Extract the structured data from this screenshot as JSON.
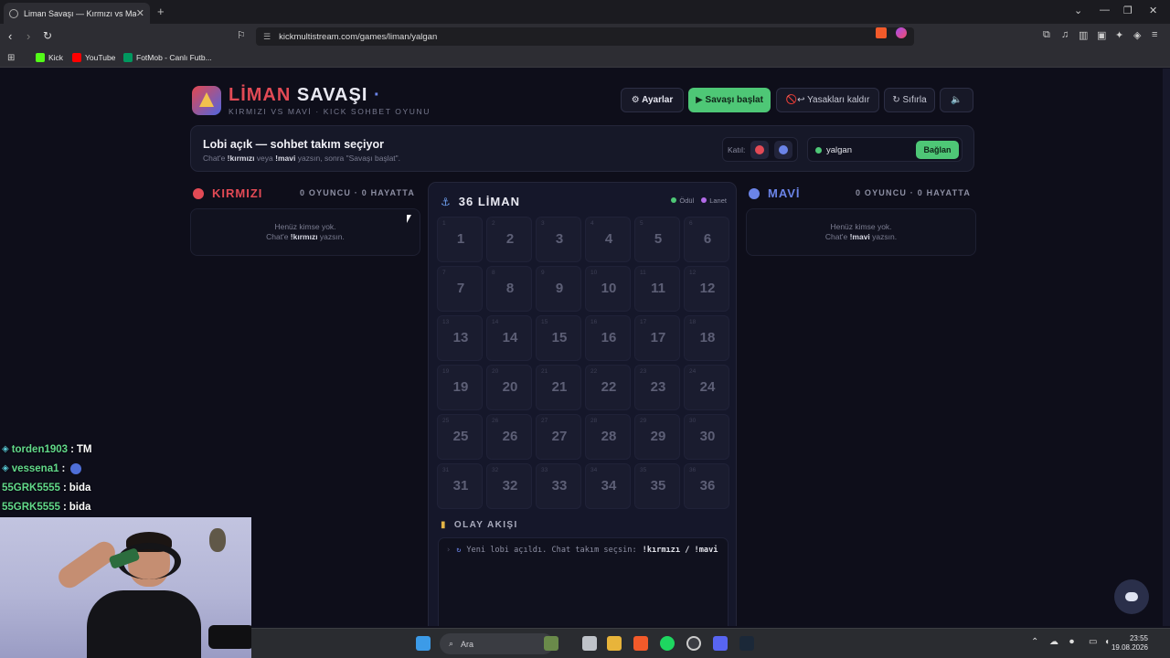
{
  "browser": {
    "tab_title": "Liman Savaşı — Kırmızı vs Mavi",
    "url": "kickmultistream.com/games/liman/yalgan",
    "bookmarks": [
      {
        "label": "Kick",
        "color": "#53fc18"
      },
      {
        "label": "YouTube",
        "color": "#ff0000"
      },
      {
        "label": "FotMob - Canlı Futb...",
        "color": "#00985f"
      }
    ]
  },
  "header": {
    "title_red": "LİMAN",
    "title_white": "SAVAŞI",
    "title_dot": "·",
    "subtitle": "KIRMIZI VS MAVİ · KICK SOHBET OYUNU",
    "settings_label": "⚙ Ayarlar",
    "start_label": "▶ Savaşı başlat",
    "unban_label": "🚫↩ Yasakları kaldır",
    "reset_label": "↻ Sıfırla",
    "sound_label": "🔈"
  },
  "lobby": {
    "title": "Lobi açık — sohbet takım seçiyor",
    "hint_prefix": "Chat'e ",
    "hint_cmd1": "!kırmızı",
    "hint_mid": " veya ",
    "hint_cmd2": "!mavi",
    "hint_suffix": " yazsın, sonra \"Savaşı başlat\".",
    "join_label": "Katıl:",
    "channel": "yalgan",
    "connect_label": "Bağlan"
  },
  "teams": {
    "red": {
      "name": "KIRMIZI",
      "count": "0 OYUNCU · 0 HAYATTA",
      "empty_line1": "Henüz kimse yok.",
      "empty_prefix": "Chat'e ",
      "empty_cmd": "!kırmızı",
      "empty_suffix": " yazsın.",
      "color": "#e24a55"
    },
    "blue": {
      "name": "MAVİ",
      "count": "0 OYUNCU · 0 HAYATTA",
      "empty_line1": "Henüz kimse yok.",
      "empty_prefix": "Chat'e ",
      "empty_cmd": "!mavi",
      "empty_suffix": " yazsın.",
      "color": "#6b84e8"
    }
  },
  "board": {
    "title": "36 LİMAN",
    "legend": [
      {
        "label": "Ödül",
        "color": "#4ec776"
      },
      {
        "label": "Lanet",
        "color": "#b26be8"
      }
    ],
    "cells": [
      1,
      2,
      3,
      4,
      5,
      6,
      7,
      8,
      9,
      10,
      11,
      12,
      13,
      14,
      15,
      16,
      17,
      18,
      19,
      20,
      21,
      22,
      23,
      24,
      25,
      26,
      27,
      28,
      29,
      30,
      31,
      32,
      33,
      34,
      35,
      36
    ]
  },
  "events": {
    "title": "OLAY AKIŞI",
    "lines": [
      {
        "text": "Yeni lobi açıldı. Chat takım seçsin: ",
        "cmd": "!kırmızı / !mavi"
      }
    ]
  },
  "chat_overlay": [
    {
      "user": "torden1903",
      "msg": "TM",
      "badge": true
    },
    {
      "user": "vessena1",
      "msg": "",
      "badge": true,
      "emote": true
    },
    {
      "user": "55GRK5555",
      "msg": "bida",
      "badge": false
    },
    {
      "user": "55GRK5555",
      "msg": "bida",
      "badge": false
    }
  ],
  "taskbar": {
    "search_label": "Ara",
    "time": "23:55",
    "date": "19.08.2026"
  }
}
